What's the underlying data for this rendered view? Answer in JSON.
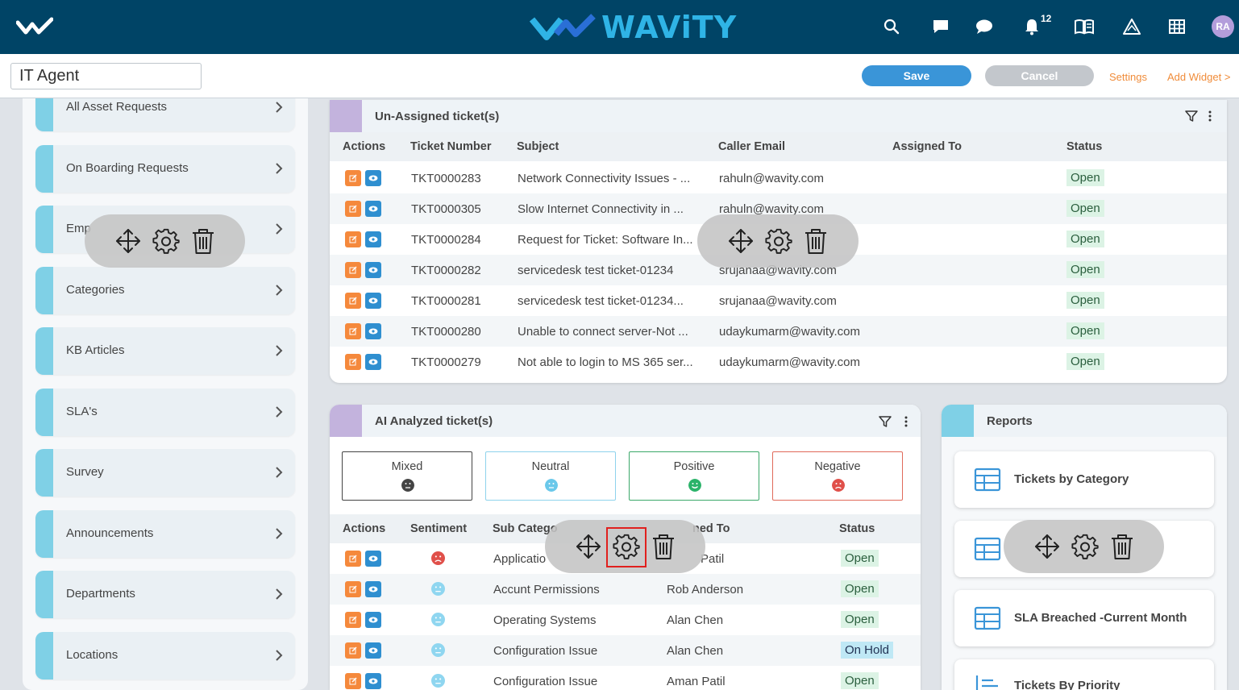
{
  "header": {
    "brand": "WAViTY",
    "notification_count": "12",
    "avatar_initials": "RA"
  },
  "toolbar": {
    "page_title_value": "IT Agent",
    "save_label": "Save",
    "cancel_label": "Cancel",
    "settings_label": "Settings",
    "add_widget_label": "Add Widget >"
  },
  "sidebar": {
    "items": [
      {
        "label": "All Asset Requests"
      },
      {
        "label": "On Boarding Requests"
      },
      {
        "label": "Emp"
      },
      {
        "label": "Categories"
      },
      {
        "label": "KB Articles"
      },
      {
        "label": "SLA's"
      },
      {
        "label": "Survey"
      },
      {
        "label": "Announcements"
      },
      {
        "label": "Departments"
      },
      {
        "label": "Locations"
      }
    ]
  },
  "unassigned": {
    "title": "Un-Assigned ticket(s)",
    "columns": [
      "Actions",
      "Ticket Number",
      "Subject",
      "Caller Email",
      "Assigned To",
      "Status"
    ],
    "rows": [
      {
        "ticket": "TKT0000283",
        "subject": "Network Connectivity Issues - ...",
        "email": "rahuln@wavity.com",
        "assigned": "",
        "status": "Open"
      },
      {
        "ticket": "TKT0000305",
        "subject": "Slow Internet Connectivity in ...",
        "email": "rahuln@wavity.com",
        "assigned": "",
        "status": "Open"
      },
      {
        "ticket": "TKT0000284",
        "subject": "Request for Ticket: Software In...",
        "email": "",
        "assigned": "",
        "status": "Open"
      },
      {
        "ticket": "TKT0000282",
        "subject": "servicedesk test ticket-01234",
        "email": "srujanaa@wavity.com",
        "assigned": "",
        "status": "Open"
      },
      {
        "ticket": "TKT0000281",
        "subject": "servicedesk test ticket-01234...",
        "email": "srujanaa@wavity.com",
        "assigned": "",
        "status": "Open"
      },
      {
        "ticket": "TKT0000280",
        "subject": "Unable to connect server-Not ...",
        "email": "udaykumarm@wavity.com",
        "assigned": "",
        "status": "Open"
      },
      {
        "ticket": "TKT0000279",
        "subject": "Not able to login to MS 365 ser...",
        "email": "udaykumarm@wavity.com",
        "assigned": "",
        "status": "Open"
      }
    ]
  },
  "ai_analyzed": {
    "title": "AI Analyzed ticket(s)",
    "sentiments": [
      {
        "label": "Mixed",
        "color": "#444444",
        "border": "#444444"
      },
      {
        "label": "Neutral",
        "color": "#6ac8ea",
        "border": "#8fd3ec"
      },
      {
        "label": "Positive",
        "color": "#2bb36a",
        "border": "#3ba86a"
      },
      {
        "label": "Negative",
        "color": "#e0504a",
        "border": "#e06a5a"
      }
    ],
    "columns": [
      "Actions",
      "Sentiment",
      "Sub Catego",
      "ned To",
      "Status"
    ],
    "rows": [
      {
        "sentiment": "negative",
        "subcategory": "Applicatio",
        "assigned": "Patil",
        "status": "Open"
      },
      {
        "sentiment": "neutral",
        "subcategory": "Accunt Permissions",
        "assigned": "Rob Anderson",
        "status": "Open"
      },
      {
        "sentiment": "neutral",
        "subcategory": "Operating Systems",
        "assigned": "Alan Chen",
        "status": "Open"
      },
      {
        "sentiment": "neutral",
        "subcategory": "Configuration Issue",
        "assigned": "Alan Chen",
        "status": "On Hold"
      },
      {
        "sentiment": "neutral",
        "subcategory": "Configuration Issue",
        "assigned": "Aman Patil",
        "status": "Open"
      }
    ]
  },
  "reports": {
    "title": "Reports",
    "items": [
      {
        "label": "Tickets by Category"
      },
      {
        "label": ""
      },
      {
        "label": "SLA Breached -Current Month"
      },
      {
        "label": "Tickets By Priority"
      }
    ]
  },
  "colors": {
    "navbar": "#004466",
    "accent_blue": "#3a95d8",
    "accent_orange": "#f08c3a",
    "unassigned_swatch": "#c3b3dd",
    "ai_swatch": "#c3b3dd",
    "reports_swatch": "#7fd0e6"
  }
}
